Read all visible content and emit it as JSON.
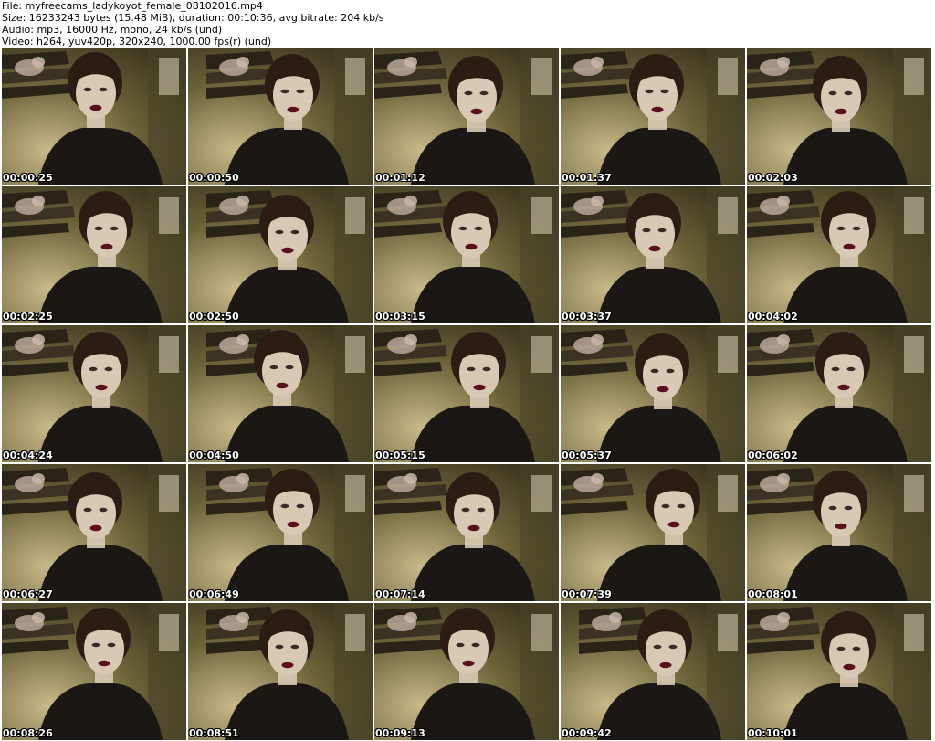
{
  "header": {
    "line1": "File: myfreecams_ladykoyot_female_08102016.mp4",
    "line2": "Size: 16233243 bytes (15.48 MiB), duration: 00:10:36, avg.bitrate: 204 kb/s",
    "line3": "Audio: mp3, 16000 Hz, mono, 24 kb/s (und)",
    "line4": "Video: h264, yuv420p, 320x240, 1000.00 fps(r) (und)"
  },
  "thumbnails": [
    {
      "time": "00:00:25"
    },
    {
      "time": "00:00:50"
    },
    {
      "time": "00:01:12"
    },
    {
      "time": "00:01:37"
    },
    {
      "time": "00:02:03"
    },
    {
      "time": "00:02:25"
    },
    {
      "time": "00:02:50"
    },
    {
      "time": "00:03:15"
    },
    {
      "time": "00:03:37"
    },
    {
      "time": "00:04:02"
    },
    {
      "time": "00:04:24"
    },
    {
      "time": "00:04:50"
    },
    {
      "time": "00:05:15"
    },
    {
      "time": "00:05:37"
    },
    {
      "time": "00:06:02"
    },
    {
      "time": "00:06:27"
    },
    {
      "time": "00:06:49"
    },
    {
      "time": "00:07:14"
    },
    {
      "time": "00:07:39"
    },
    {
      "time": "00:08:01"
    },
    {
      "time": "00:08:26"
    },
    {
      "time": "00:08:51"
    },
    {
      "time": "00:09:13"
    },
    {
      "time": "00:09:42"
    },
    {
      "time": "00:10:01"
    }
  ],
  "colors": {
    "wall": "#6b6238",
    "wall_light": "#c9b98a",
    "shelf": "#2a2418",
    "clothing": "#1a1714",
    "skin": "#d8c9b4",
    "hair": "#2b1d14",
    "lips": "#5a0f1c",
    "stamp_text": "#ffffff"
  }
}
